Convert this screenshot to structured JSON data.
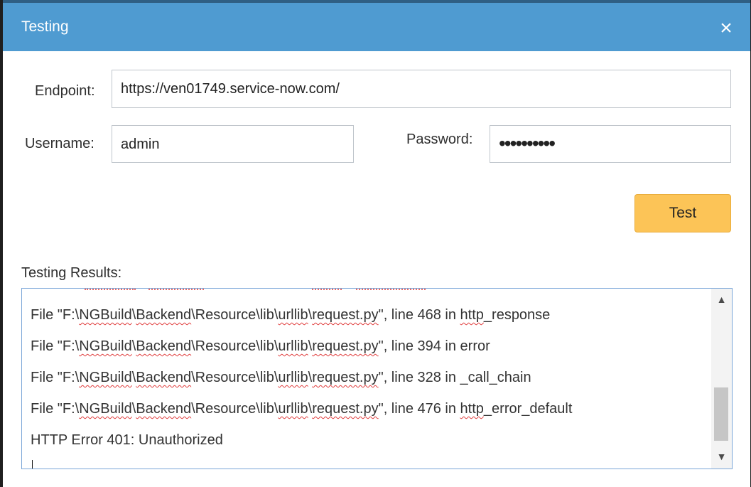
{
  "dialog": {
    "title": "Testing",
    "close_icon": "close-icon"
  },
  "form": {
    "endpoint_label": "Endpoint:",
    "endpoint_value": "https://ven01749.service-now.com/",
    "username_label": "Username:",
    "username_value": "admin",
    "password_label": "Password:",
    "password_value": "••••••••••",
    "test_button": "Test"
  },
  "results": {
    "label": "Testing Results:",
    "lines": [
      {
        "prefix": "File \"F:\\",
        "squiggle1": "NGBuild",
        "mid1": "\\",
        "squiggle2": "Backend",
        "mid2": "\\Resource\\lib\\",
        "squiggle3": "urllib",
        "mid3": "\\",
        "squiggle4": "request.py",
        "suffix": "\", line 468 in ",
        "tail_squiggle": "http",
        "tail": "_response"
      },
      {
        "prefix": "File \"F:\\",
        "squiggle1": "NGBuild",
        "mid1": "\\",
        "squiggle2": "Backend",
        "mid2": "\\Resource\\lib\\",
        "squiggle3": "urllib",
        "mid3": "\\",
        "squiggle4": "request.py",
        "suffix": "\", line 394 in error",
        "tail_squiggle": "",
        "tail": ""
      },
      {
        "prefix": "File \"F:\\",
        "squiggle1": "NGBuild",
        "mid1": "\\",
        "squiggle2": "Backend",
        "mid2": "\\Resource\\lib\\",
        "squiggle3": "urllib",
        "mid3": "\\",
        "squiggle4": "request.py",
        "suffix": "\", line 328 in _call_chain",
        "tail_squiggle": "",
        "tail": ""
      },
      {
        "prefix": "File \"F:\\",
        "squiggle1": "NGBuild",
        "mid1": "\\",
        "squiggle2": "Backend",
        "mid2": "\\Resource\\lib\\",
        "squiggle3": "urllib",
        "mid3": "\\",
        "squiggle4": "request.py",
        "suffix": "\", line 476 in ",
        "tail_squiggle": "http",
        "tail": "_error_default"
      },
      {
        "prefix": "HTTP Error 401: Unauthorized",
        "squiggle1": "",
        "mid1": "",
        "squiggle2": "",
        "mid2": "",
        "squiggle3": "",
        "mid3": "",
        "squiggle4": "",
        "suffix": "",
        "tail_squiggle": "",
        "tail": ""
      }
    ],
    "scroll_up_icon": "triangle-up-icon",
    "scroll_down_icon": "triangle-down-icon"
  },
  "colors": {
    "title_bar": "#4f9bd1",
    "test_button": "#fcc457",
    "results_border": "#7aa6d8",
    "spellcheck": "#e03b3b"
  }
}
